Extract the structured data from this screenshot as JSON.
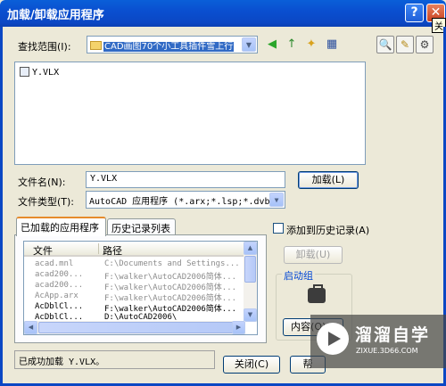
{
  "window": {
    "title": "加载/卸载应用程序",
    "help_label": "?",
    "close_label": "✕",
    "tooltip_fragment": "关"
  },
  "lookin": {
    "label": "查找范围(I):",
    "value": "CAD画图70个小工具插件雪上行"
  },
  "toolbar": {
    "back_glyph": "◀",
    "up_glyph": "↑",
    "newfolder_glyph": "✦",
    "views_glyph": "▦"
  },
  "file_list": {
    "items": [
      "Y.VLX"
    ]
  },
  "filename": {
    "label": "文件名(N):",
    "value": "Y.VLX"
  },
  "filetype": {
    "label": "文件类型(T):",
    "value": "AutoCAD 应用程序 (*.arx;*.lsp;*.dvb;"
  },
  "load_button": "加载(L)",
  "tabs": [
    "已加载的应用程序",
    "历史记录列表"
  ],
  "loaded_apps": {
    "columns": [
      "文件",
      "路径"
    ],
    "rows": [
      {
        "file": "acad.mnl",
        "path": "C:\\Documents and Settings...",
        "dim": true
      },
      {
        "file": "acad200...",
        "path": "F:\\walker\\AutoCAD2006简体...",
        "dim": true
      },
      {
        "file": "acad200...",
        "path": "F:\\walker\\AutoCAD2006简体...",
        "dim": true
      },
      {
        "file": "AcApp.arx",
        "path": "F:\\walker\\AutoCAD2006简体...",
        "dim": true
      },
      {
        "file": "AcDblCl...",
        "path": "F:\\walker\\AutoCAD2006简体...",
        "dim": false
      },
      {
        "file": "AcDblCl...",
        "path": "D:\\AutoCAD2006\\",
        "dim": false
      }
    ]
  },
  "history_checkbox": "添加到历史记录(A)",
  "unload_button": "卸载(U)",
  "startup_group": {
    "title": "启动组",
    "contents_button": "内容(O)..."
  },
  "status_text": "已成功加载 Y.VLX。",
  "close_button": "关闭(C)",
  "help_button": "帮",
  "watermark": {
    "title": "溜溜自学",
    "subtitle": "ZIXUE.3D66.COM"
  }
}
